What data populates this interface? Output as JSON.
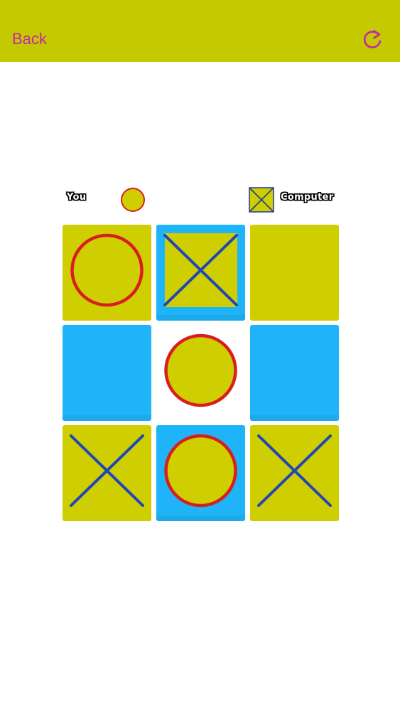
{
  "header": {
    "back_label": "Back",
    "restart_icon": "restart-icon",
    "bar_color": "#c5c900",
    "accent_color": "#c02aa6"
  },
  "players": {
    "you_label": "You",
    "computer_label": "Computer",
    "you_mark": "O",
    "computer_mark": "X"
  },
  "board": {
    "cells": [
      {
        "mark": "O",
        "color": "yellow"
      },
      {
        "mark": "X",
        "color": "blue"
      },
      {
        "mark": "",
        "color": "yellow"
      },
      {
        "mark": "",
        "color": "blue"
      },
      {
        "mark": "O",
        "color": "white"
      },
      {
        "mark": "",
        "color": "blue"
      },
      {
        "mark": "X",
        "color": "yellow"
      },
      {
        "mark": "O",
        "color": "blue"
      },
      {
        "mark": "X",
        "color": "yellow"
      }
    ],
    "colors": {
      "yellow": "#cfce00",
      "blue": "#1fb4f8",
      "white": "#ffffff",
      "o_stroke": "#d81f1f",
      "x_stroke": "#2046b8"
    }
  }
}
